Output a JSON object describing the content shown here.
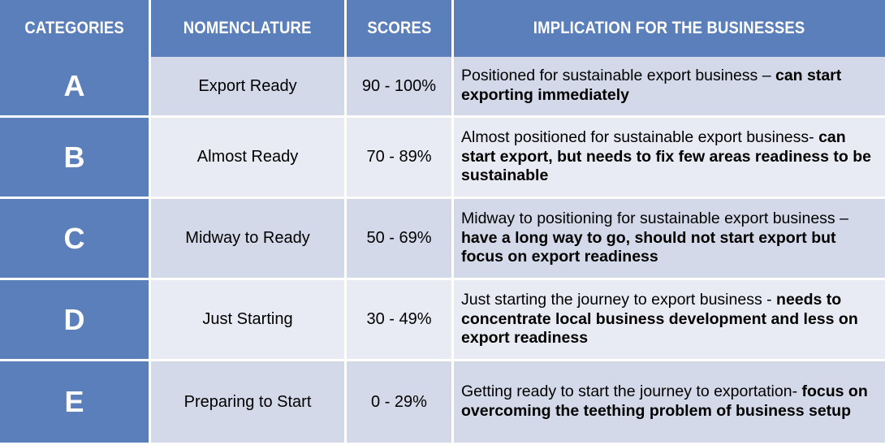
{
  "table": {
    "columns": [
      {
        "key": "categories",
        "label": "CATEGORIES"
      },
      {
        "key": "nomenclature",
        "label": "NOMENCLATURE"
      },
      {
        "key": "scores",
        "label": "SCORES"
      },
      {
        "key": "implication",
        "label": "IMPLICATION FOR THE BUSINESSES"
      }
    ],
    "rows": [
      {
        "category": "A",
        "nomenclature": "Export Ready",
        "score": "90 - 100%",
        "implication_lead": "Positioned for sustainable export business – ",
        "implication_emph": "can start exporting immediately",
        "shade": "dark"
      },
      {
        "category": "B",
        "nomenclature": "Almost Ready",
        "score": "70 - 89%",
        "implication_lead": "Almost positioned for sustainable export business- ",
        "implication_emph": "can start export, but needs to fix few areas readiness to be sustainable",
        "shade": "light"
      },
      {
        "category": "C",
        "nomenclature": "Midway to Ready",
        "score": "50 - 69%",
        "implication_lead": "Midway to positioning for sustainable export business – ",
        "implication_emph": "have a long way to go, should not start export but focus on export readiness",
        "shade": "dark"
      },
      {
        "category": "D",
        "nomenclature": "Just Starting",
        "score": "30 - 49%",
        "implication_lead": "Just starting the journey to export business - ",
        "implication_emph": "needs to concentrate local business development and less on export readiness",
        "shade": "light"
      },
      {
        "category": "E",
        "nomenclature": "Preparing to Start",
        "score": "0 - 29%",
        "implication_lead": "Getting ready to start the journey to exportation-  ",
        "implication_emph": "focus on overcoming the teething problem of business setup",
        "shade": "dark"
      }
    ]
  },
  "colors": {
    "header_blue": "#5b7fba",
    "category_blue": "#5b7fba",
    "row_dark": "#d3d9e8",
    "row_light": "#e8ebf3",
    "grid_white": "#ffffff",
    "text_dark": "#000000",
    "header_text": "#ffffff"
  }
}
